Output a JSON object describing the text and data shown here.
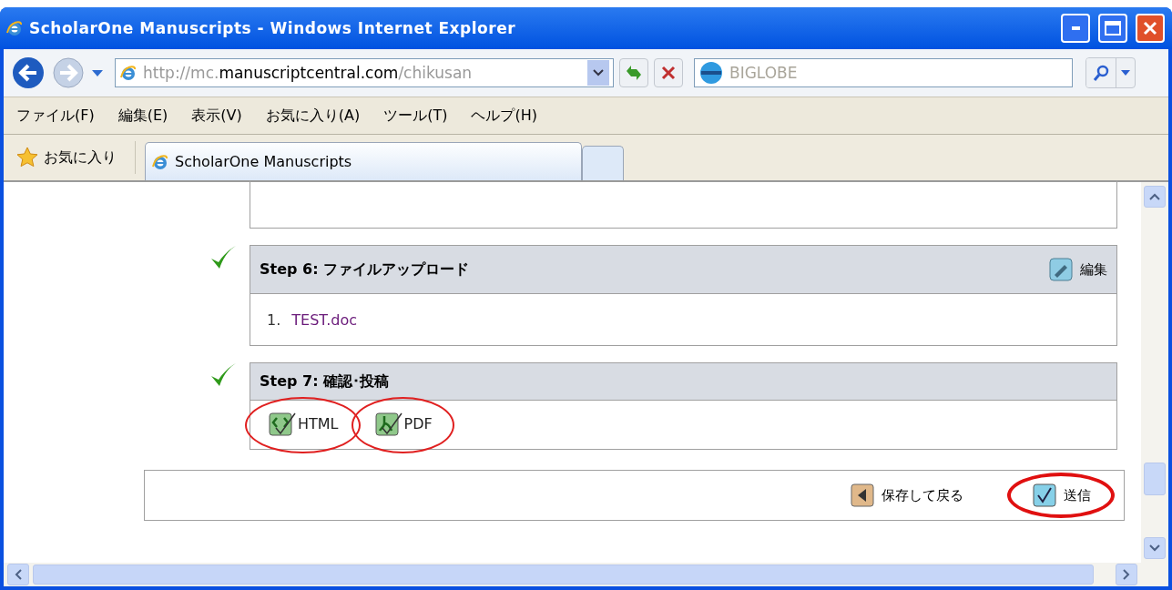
{
  "window": {
    "title": "ScholarOne Manuscripts - Windows Internet Explorer"
  },
  "address_bar": {
    "url_prefix": "http://mc.",
    "url_domain": "manuscriptcentral.com",
    "url_path": "/chikusan"
  },
  "search": {
    "placeholder": "BIGLOBE"
  },
  "menu": [
    "ファイル(F)",
    "編集(E)",
    "表示(V)",
    "お気に入り(A)",
    "ツール(T)",
    "ヘルプ(H)"
  ],
  "favorites": {
    "label": "お気に入り"
  },
  "tabs": [
    {
      "label": "ScholarOne Manuscripts",
      "selected": true
    }
  ],
  "steps": [
    {
      "kind": "partial"
    },
    {
      "kind": "files",
      "complete": true,
      "title": "Step 6:",
      "subtitle": "ファイルアップロード",
      "edit_label": "編集",
      "files": [
        {
          "number": "1.",
          "name": "TEST.doc"
        }
      ]
    },
    {
      "kind": "proofs",
      "complete": true,
      "title": "Step 7:",
      "subtitle": "確認･投稿",
      "proofs": [
        {
          "kind": "html",
          "label": "HTML",
          "circled": true
        },
        {
          "kind": "pdf",
          "label": "PDF",
          "circled": true
        }
      ]
    }
  ],
  "footer": {
    "buttons": [
      {
        "kind": "back",
        "label": "保存して戻る",
        "circled": false
      },
      {
        "kind": "submit",
        "label": "送信",
        "circled": true
      }
    ]
  }
}
